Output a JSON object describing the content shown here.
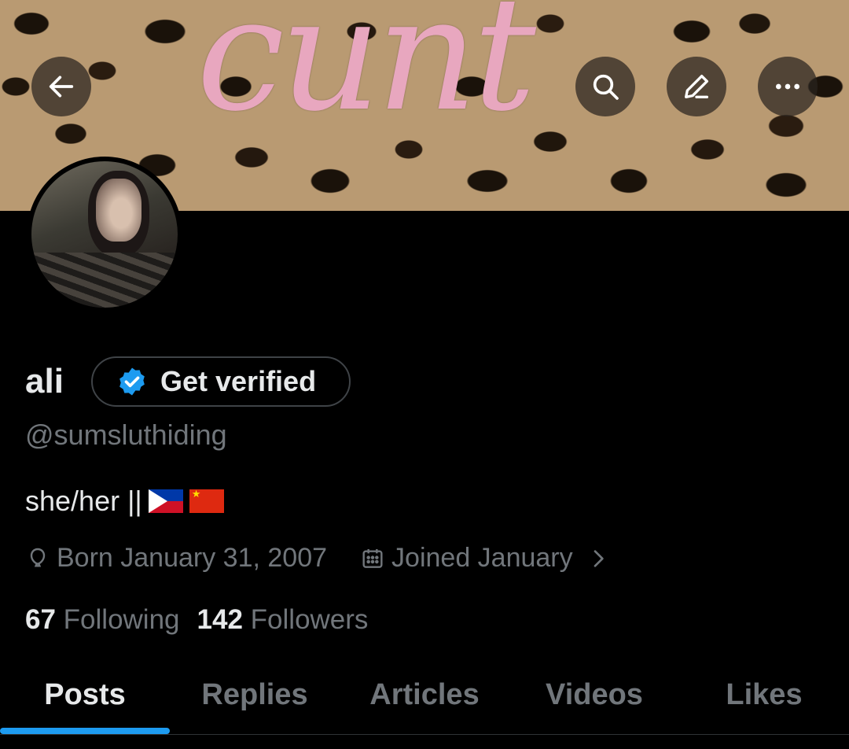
{
  "banner": {
    "text": "cunt"
  },
  "header": {
    "back_icon": "arrow-left-icon",
    "search_icon": "search-icon",
    "edit_icon": "pencil-icon",
    "more_icon": "more-horizontal-icon"
  },
  "profile": {
    "name": "ali",
    "verify_label": "Get verified",
    "handle": "@sumsluthiding",
    "bio_text": "she/her ||",
    "bio_flags": [
      "philippines-flag",
      "china-flag"
    ],
    "birthday": "Born January 31, 2007",
    "joined": "Joined January",
    "following_count": "67",
    "following_label": "Following",
    "followers_count": "142",
    "followers_label": "Followers"
  },
  "tabs": [
    {
      "label": "Posts",
      "active": true
    },
    {
      "label": "Replies",
      "active": false
    },
    {
      "label": "Articles",
      "active": false
    },
    {
      "label": "Videos",
      "active": false
    },
    {
      "label": "Likes",
      "active": false
    }
  ],
  "colors": {
    "accent": "#1d9bf0",
    "text_primary": "#e7e9ea",
    "text_secondary": "#71767b",
    "banner_text": "#e8a7bf"
  }
}
